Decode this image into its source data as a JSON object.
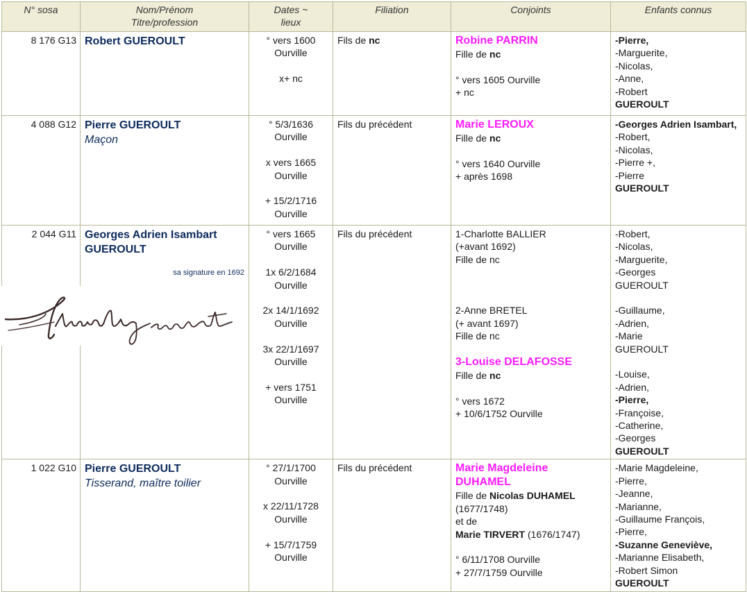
{
  "headers": {
    "sosa": "N° sosa",
    "name1": "Nom/Prénom",
    "name2": "Titre/profession",
    "dates1": "Dates ~",
    "dates2": "lieux",
    "filiation": "Filiation",
    "conjoints": "Conjoints",
    "enfants": "Enfants connus"
  },
  "rows": [
    {
      "sosa": "8 176 G13",
      "name": "Robert GUEROULT",
      "dates": [
        "° vers 1600",
        "Ourville",
        "",
        "x+ nc"
      ],
      "filiation_text": "Fils de ",
      "filiation_bold": "nc",
      "spouse_name": "Robine PARRIN",
      "spouse_parent_prefix": "Fille de ",
      "spouse_parent": "nc",
      "spouse_birth": "° vers 1605 Ourville",
      "spouse_death": "+ nc",
      "children_first": "-Pierre,",
      "children": [
        "-Marguerite,",
        "-Nicolas,",
        "-Anne,",
        "-Robert"
      ],
      "children_last": "GUEROULT"
    },
    {
      "sosa": "4 088 G12",
      "name": "Pierre GUEROULT",
      "title": "Maçon",
      "dates": [
        "° 5/3/1636",
        "Ourville",
        "",
        "x vers 1665",
        "Ourville",
        "",
        "+ 15/2/1716",
        "Ourville"
      ],
      "filiation_text": "Fils du précédent",
      "spouse_name": "Marie LEROUX",
      "spouse_parent_prefix": "Fille de ",
      "spouse_parent": "nc",
      "spouse_birth": "° vers 1640 Ourville",
      "spouse_death": "+ après 1698",
      "children_first": "-Georges Adrien Isambart,",
      "children": [
        "-Robert,",
        "-Nicolas,",
        "-Pierre +,",
        "-Pierre"
      ],
      "children_last": "GUEROULT"
    },
    {
      "sosa": "2 044 G11",
      "name": "Georges Adrien Isambart GUEROULT",
      "signature_caption": "sa signature en 1692",
      "dates": [
        "° vers 1665",
        "Ourville",
        "",
        "1x 6/2/1684",
        "Ourville",
        "",
        "2x 14/1/1692",
        "Ourville",
        "",
        "3x 22/1/1697",
        "Ourville",
        "",
        "+ vers 1751",
        "Ourville"
      ],
      "filiation_text": "Fils du précédent",
      "spouse1": [
        "1-Charlotte BALLIER",
        "(+avant 1692)",
        "Fille de nc"
      ],
      "spouse2": [
        "2-Anne BRETEL",
        "(+ avant 1697)",
        "Fille de nc"
      ],
      "spouse3_name": "3-Louise DELAFOSSE",
      "spouse3_parent_prefix": "Fille de ",
      "spouse3_parent": "nc",
      "spouse3_birth": "° vers 1672",
      "spouse3_death": "+ 10/6/1752 Ourville",
      "children_g1": [
        "-Robert,",
        "-Nicolas,",
        "-Marguerite,",
        "-Georges",
        "GUEROULT"
      ],
      "children_g2": [
        "-Guillaume,",
        "-Adrien,",
        "-Marie",
        "GUEROULT"
      ],
      "children_g3_a": [
        "-Louise,",
        "-Adrien,"
      ],
      "children_g3_bold": "-Pierre,",
      "children_g3_b": [
        "-Françoise,",
        "-Catherine,",
        "-Georges"
      ],
      "children_g3_last": "GUEROULT"
    },
    {
      "sosa": "1 022 G10",
      "name": "Pierre GUEROULT",
      "title": "Tisserand, maître toilier",
      "dates": [
        "° 27/1/1700",
        "Ourville",
        "",
        "x 22/11/1728",
        "Ourville",
        "",
        "+ 15/7/1759",
        "Ourville"
      ],
      "filiation_text": "Fils du précédent",
      "spouse_name": "Marie Magdeleine DUHAMEL",
      "spouse_parent_prefix": "Fille de ",
      "spouse_father": "Nicolas DUHAMEL",
      "spouse_father_dates": "(1677/1748)",
      "spouse_and": "et de",
      "spouse_mother": "Marie TIRVERT",
      "spouse_mother_dates": " (1676/1747)",
      "spouse_birth": "° 6/11/1708 Ourville",
      "spouse_death": "+ 27/7/1759 Ourville",
      "children_a": [
        "-Marie Magdeleine,",
        "-Pierre,",
        "-Jeanne,",
        "-Marianne,",
        "-Guillaume François,",
        "-Pierre,"
      ],
      "children_bold": "-Suzanne Geneviève,",
      "children_b": [
        "-Marianne Elisabeth,",
        "-Robert Simon"
      ],
      "children_last": "GUEROULT"
    }
  ]
}
